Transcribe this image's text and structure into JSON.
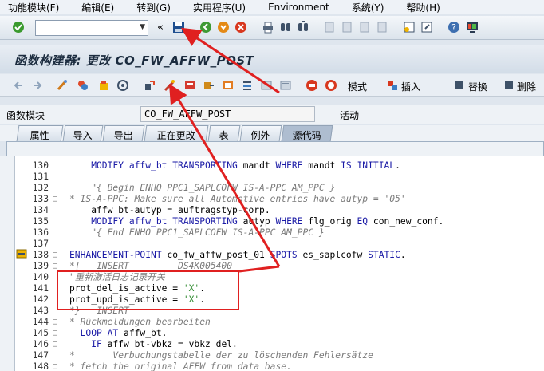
{
  "menu": {
    "items": [
      "功能模块(F)",
      "编辑(E)",
      "转到(G)",
      "实用程序(U)",
      "Environment",
      "系统(Y)",
      "帮助(H)"
    ]
  },
  "toolbar": {
    "command_value": "",
    "command_placeholder": "",
    "back_glyph": "«"
  },
  "title": {
    "text": "函数构建器: 更改 CO_FW_AFFW_POST"
  },
  "app_toolbar": {
    "pattern_label": "模式",
    "insert_label": "插入",
    "replace_label": "替换",
    "delete_label": "删除"
  },
  "header_fields": {
    "module_label": "函数模块",
    "module_value": "CO_FW_AFFW_POST",
    "status": "活动"
  },
  "tabs": [
    {
      "label": "属性",
      "active": false
    },
    {
      "label": "导入",
      "active": false
    },
    {
      "label": "导出",
      "active": false
    },
    {
      "label": "正在更改",
      "active": false
    },
    {
      "label": "表",
      "active": false
    },
    {
      "label": "例外",
      "active": false
    },
    {
      "label": "源代码",
      "active": true
    }
  ],
  "code": {
    "lines": [
      {
        "num": "130",
        "fold": "",
        "segments": [
          {
            "t": "    MODIFY affw_bt ",
            "c": "kw"
          },
          {
            "t": "TRANSPORTING",
            "c": "kw"
          },
          {
            "t": " mandt ",
            "c": "norm"
          },
          {
            "t": "WHERE",
            "c": "kw"
          },
          {
            "t": " mandt ",
            "c": "norm"
          },
          {
            "t": "IS INITIAL",
            "c": "kw"
          },
          {
            "t": ".",
            "c": "norm"
          }
        ]
      },
      {
        "num": "131",
        "fold": "",
        "segments": [
          {
            "t": "",
            "c": "norm"
          }
        ]
      },
      {
        "num": "132",
        "fold": "",
        "segments": [
          {
            "t": "    \"{ Begin ENHO PPC1_SAPLCOFW IS-A-PPC AM_PPC }",
            "c": "com"
          }
        ]
      },
      {
        "num": "133",
        "fold": "□",
        "segments": [
          {
            "t": "* IS-A-PPC: Make sure all Automotive entries have autyp = '05'",
            "c": "com"
          }
        ]
      },
      {
        "num": "134",
        "fold": "",
        "segments": [
          {
            "t": "    affw_bt-autyp = auftragstyp-corp.",
            "c": "norm"
          }
        ]
      },
      {
        "num": "135",
        "fold": "",
        "segments": [
          {
            "t": "    MODIFY affw_bt ",
            "c": "kw"
          },
          {
            "t": "TRANSPORTING",
            "c": "kw"
          },
          {
            "t": " autyp ",
            "c": "norm"
          },
          {
            "t": "WHERE",
            "c": "kw"
          },
          {
            "t": " flg_orig ",
            "c": "norm"
          },
          {
            "t": "EQ",
            "c": "kw"
          },
          {
            "t": " con_new_conf.",
            "c": "norm"
          }
        ]
      },
      {
        "num": "136",
        "fold": "",
        "segments": [
          {
            "t": "    \"{ End ENHO PPC1_SAPLCOFW IS-A-PPC AM_PPC }",
            "c": "com"
          }
        ]
      },
      {
        "num": "137",
        "fold": "",
        "segments": [
          {
            "t": "",
            "c": "norm"
          }
        ]
      },
      {
        "num": "138",
        "fold": "□",
        "segments": [
          {
            "t": "ENHANCEMENT-POINT",
            "c": "kw"
          },
          {
            "t": " co_fw_affw_post_01 ",
            "c": "norm"
          },
          {
            "t": "SPOTS",
            "c": "kw"
          },
          {
            "t": " es_saplcofw ",
            "c": "norm"
          },
          {
            "t": "STATIC",
            "c": "kw"
          },
          {
            "t": ".",
            "c": "norm"
          }
        ]
      },
      {
        "num": "139",
        "fold": "□",
        "segments": [
          {
            "t": "*{   INSERT         DS4K005400",
            "c": "com"
          }
        ]
      },
      {
        "num": "140",
        "fold": "",
        "segments": [
          {
            "t": "\"重新激活日志记录开关",
            "c": "com"
          }
        ]
      },
      {
        "num": "141",
        "fold": "",
        "segments": [
          {
            "t": "prot_del_is_active = ",
            "c": "norm"
          },
          {
            "t": "'X'",
            "c": "str"
          },
          {
            "t": ".",
            "c": "norm"
          }
        ]
      },
      {
        "num": "142",
        "fold": "",
        "segments": [
          {
            "t": "prot_upd_is_active = ",
            "c": "norm"
          },
          {
            "t": "'X'",
            "c": "str"
          },
          {
            "t": ".",
            "c": "norm"
          }
        ]
      },
      {
        "num": "143",
        "fold": "",
        "segments": [
          {
            "t": "*}   INSERT",
            "c": "com"
          }
        ]
      },
      {
        "num": "144",
        "fold": "□",
        "segments": [
          {
            "t": "* Rückmeldungen bearbeiten",
            "c": "com"
          }
        ]
      },
      {
        "num": "145",
        "fold": "□",
        "segments": [
          {
            "t": "  LOOP AT",
            "c": "kw"
          },
          {
            "t": " affw_bt.",
            "c": "norm"
          }
        ]
      },
      {
        "num": "146",
        "fold": "□",
        "segments": [
          {
            "t": "    IF",
            "c": "kw"
          },
          {
            "t": " affw_bt-vbkz = vbkz_del.",
            "c": "norm"
          }
        ]
      },
      {
        "num": "147",
        "fold": "",
        "segments": [
          {
            "t": "*       Verbuchungstabelle der zu löschenden Fehlersätze",
            "c": "com"
          }
        ]
      },
      {
        "num": "148",
        "fold": "□",
        "segments": [
          {
            "t": "* fetch the original AFFW from data base.",
            "c": "com"
          }
        ]
      }
    ]
  },
  "colors": {
    "keyword": "#1a1aa6",
    "comment": "#7a7a7a",
    "string": "#2f8a2f",
    "annotation": "#e02020"
  }
}
